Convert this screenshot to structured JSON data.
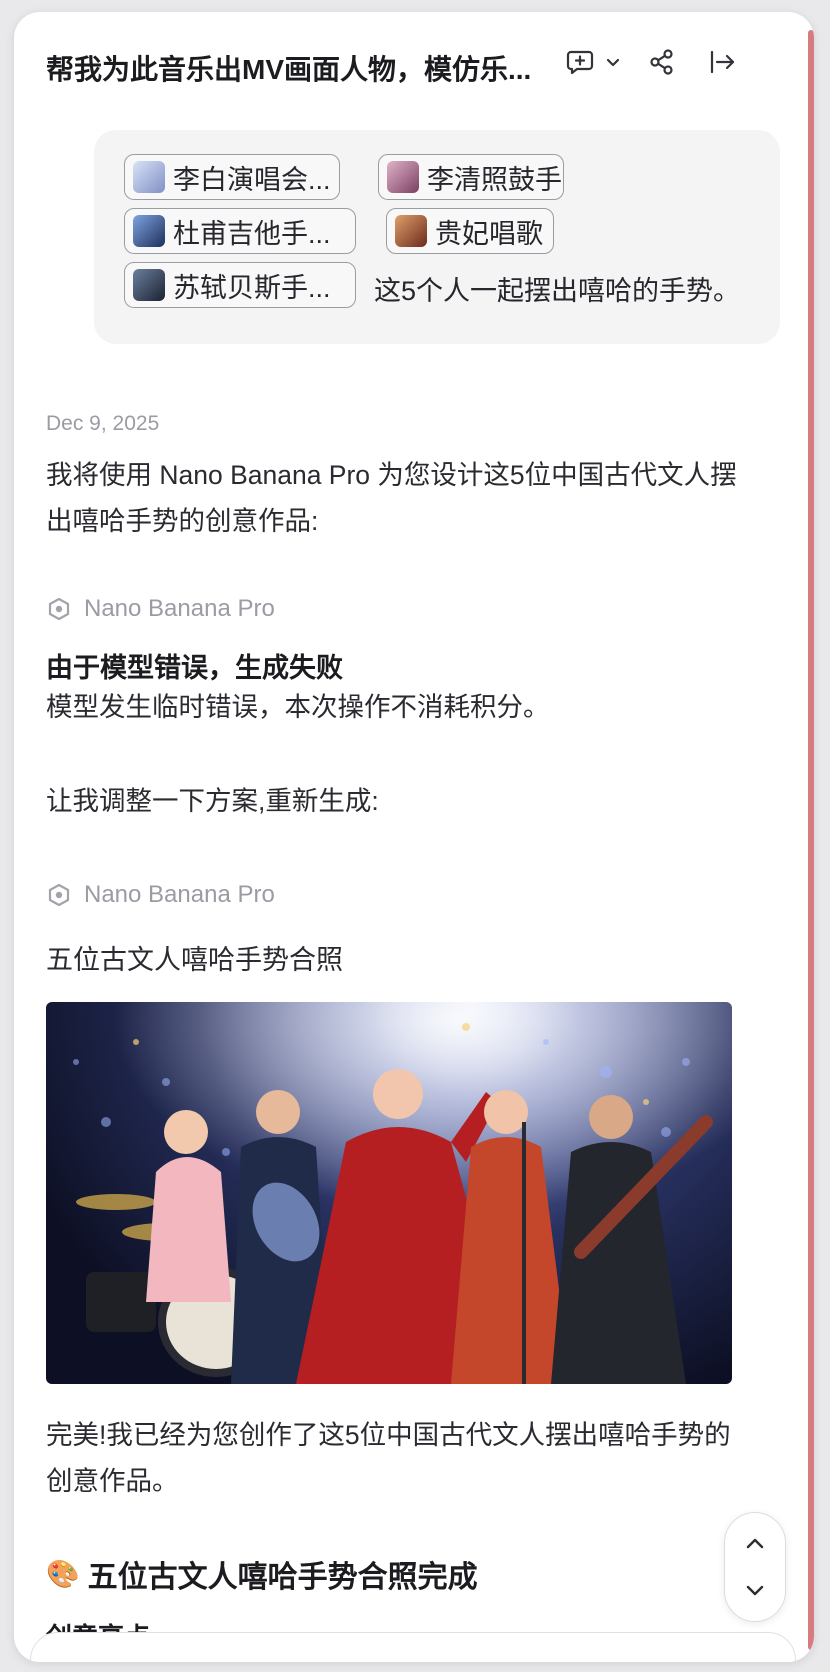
{
  "header": {
    "title": "帮我为此音乐出MV画面人物，模仿乐...",
    "icons": [
      "new-chat-icon",
      "chevron-down-icon",
      "share-icon",
      "exit-panel-icon"
    ]
  },
  "user_message": {
    "chips": [
      {
        "label": "李白演唱会...",
        "thumb_color": "#a9b7df"
      },
      {
        "label": "李清照鼓手",
        "thumb_color": "#a9698c"
      },
      {
        "label": "杜甫吉他手...",
        "thumb_color": "#3b5c9e"
      },
      {
        "label": "贵妃唱歌",
        "thumb_color": "#b4543a"
      },
      {
        "label": "苏轼贝斯手...",
        "thumb_color": "#35455e"
      }
    ],
    "text": "这5个人一起摆出嘻哈的手势。"
  },
  "assistant": {
    "date": "Dec 9, 2025",
    "intro": "我将使用 Nano Banana Pro 为您设计这5位中国古代文人摆出嘻哈手势的创意作品:",
    "tool_name": "Nano Banana Pro",
    "error_title": "由于模型错误，生成失败",
    "error_body": "模型发生临时错误，本次操作不消耗积分。",
    "retry_text": "让我调整一下方案,重新生成:",
    "tool_name_2": "Nano Banana Pro",
    "image_title": "五位古文人嘻哈手势合照",
    "result_text": "完美!我已经为您创作了这5位中国古代文人摆出嘻哈手势的创意作品。",
    "heading_emoji": "🎨",
    "heading": "五位古文人嘻哈手势合照完成",
    "subheading": "创意亮点:"
  },
  "colors": {
    "accent_edge": "#d67b80",
    "bubble_bg": "#f4f4f5",
    "muted_text": "#9b9ba4"
  }
}
